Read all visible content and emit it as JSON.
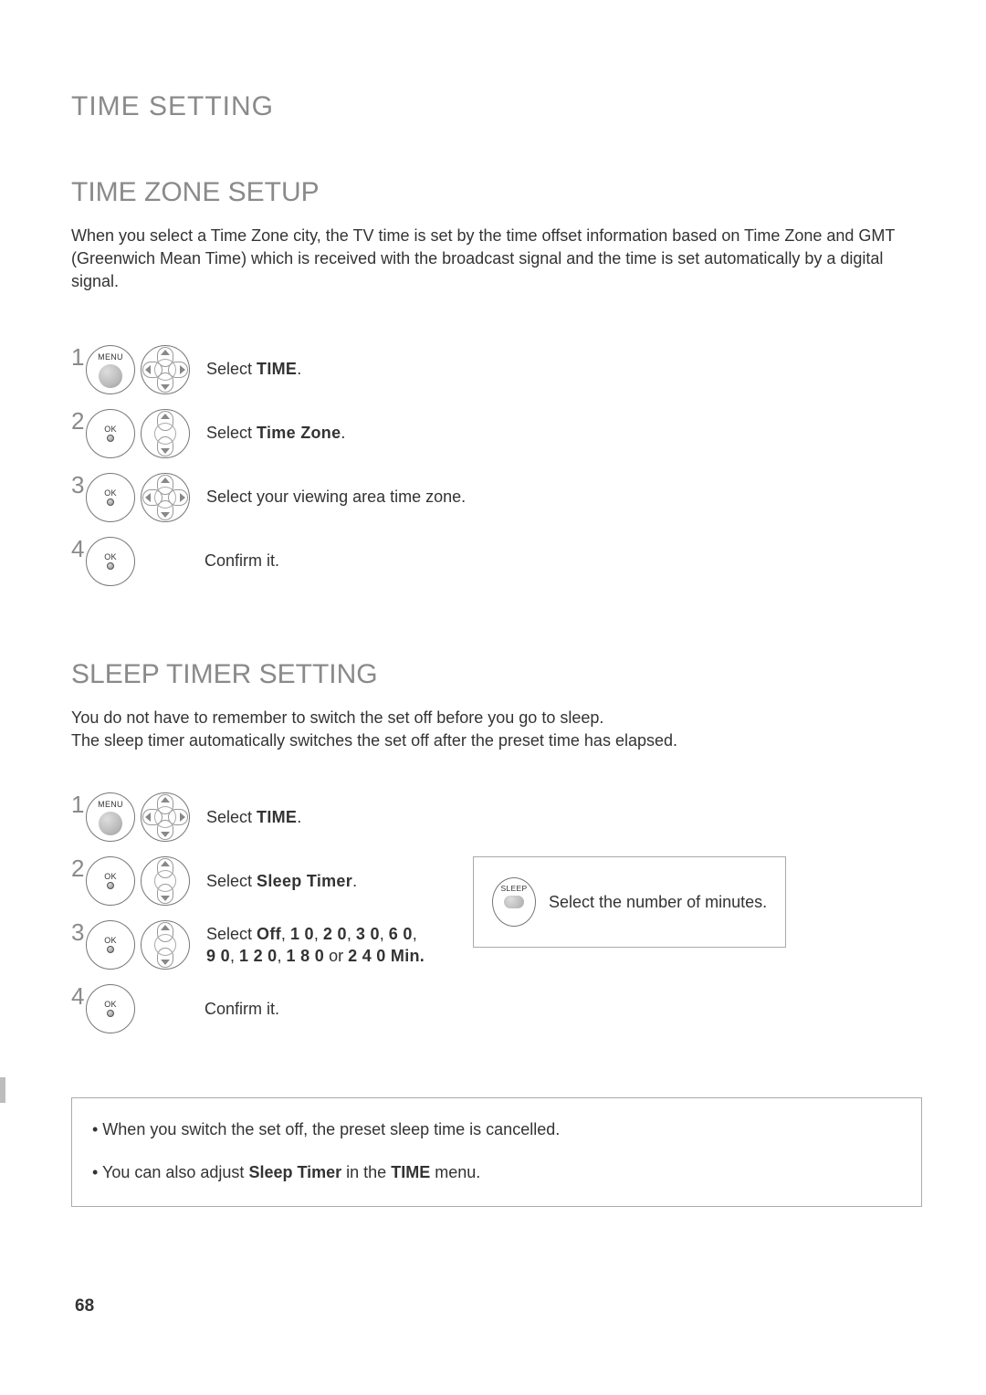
{
  "page_number": "68",
  "title_main": "TIME SETTING",
  "section1": {
    "heading": "TIME ZONE SETUP",
    "intro": "When you select a Time Zone city, the TV time is set by the time offset information based on Time Zone and GMT (Greenwich Mean Time) which is received with the broadcast signal and the time is set automatically by a digital signal.",
    "steps": [
      {
        "num": "1",
        "btn1": "MENU",
        "dpad": "full",
        "text_pre": "Select ",
        "text_bold": "TIME",
        "text_post": "."
      },
      {
        "num": "2",
        "btn1": "OK",
        "dpad": "ud",
        "text_pre": "Select ",
        "text_bold": "Time Zone",
        "text_post": "."
      },
      {
        "num": "3",
        "btn1": "OK",
        "dpad": "full",
        "text_pre": "Select your viewing area time zone.",
        "text_bold": "",
        "text_post": ""
      },
      {
        "num": "4",
        "btn1": "OK",
        "dpad": "",
        "text_pre": "Confirm it.",
        "text_bold": "",
        "text_post": ""
      }
    ]
  },
  "section2": {
    "heading": "SLEEP TIMER SETTING",
    "intro_line1": "You do not have to remember to switch the set off before you go to sleep.",
    "intro_line2": "The sleep timer automatically switches the set off after the preset time has elapsed.",
    "steps": [
      {
        "num": "1",
        "btn1": "MENU",
        "dpad": "full",
        "text_pre": "Select ",
        "text_bold": "TIME",
        "text_post": "."
      },
      {
        "num": "2",
        "btn1": "OK",
        "dpad": "ud",
        "text_pre": "Select ",
        "text_bold": "Sleep Timer",
        "text_post": "."
      },
      {
        "num": "3",
        "btn1": "OK",
        "dpad": "ud",
        "text_pre": "Select ",
        "text_bold": "Off",
        "text_post": ", ",
        "extra_bold1": "1 0",
        "c1": ", ",
        "extra_bold2": "2 0",
        "c2": ", ",
        "extra_bold3": "3 0",
        "c3": ", ",
        "extra_bold4": "6 0",
        "c4": ", ",
        "line2_bold1": "9 0",
        "l2c1": ", ",
        "line2_bold2": "1 2 0",
        "l2c2": ", ",
        "line2_bold3": "1 8 0",
        "l2or": " or ",
        "line2_bold4": "2 4 0  Min."
      },
      {
        "num": "4",
        "btn1": "OK",
        "dpad": "",
        "text_pre": "Confirm it.",
        "text_bold": "",
        "text_post": ""
      }
    ],
    "side_box": {
      "btn_label": "SLEEP",
      "text": "Select the number of minutes."
    }
  },
  "notes": {
    "n1_pre": "• When you switch the set off, the preset sleep time is cancelled.",
    "n2_pre": "• You can also adjust ",
    "n2_b1": "Sleep Timer",
    "n2_mid": " in the ",
    "n2_b2": "TIME",
    "n2_post": " menu."
  }
}
